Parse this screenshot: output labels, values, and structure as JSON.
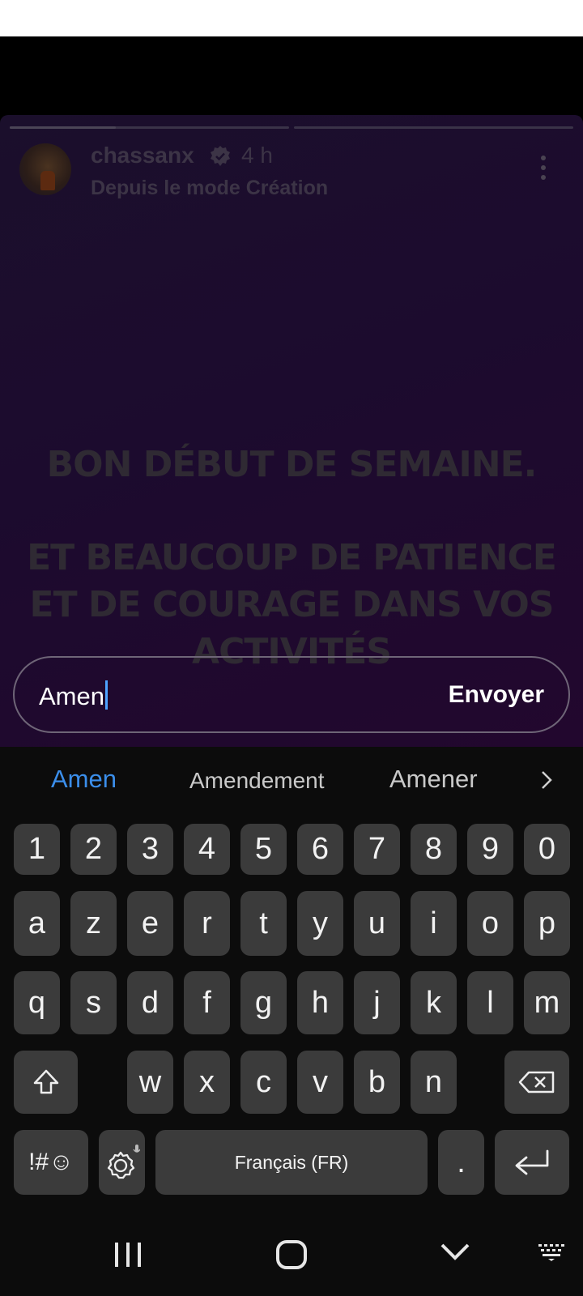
{
  "story": {
    "username": "chassanx",
    "time": "4 h",
    "subtitle": "Depuis le mode Création",
    "text_line1": "BON DÉBUT DE SEMAINE.",
    "text_line2": "ET BEAUCOUP DE PATIENCE",
    "text_line3": "ET DE COURAGE DANS VOS",
    "text_line4": "ACTIVITÉS",
    "progress": [
      0.38,
      0
    ]
  },
  "reply": {
    "value": "Amen",
    "send_label": "Envoyer"
  },
  "keyboard": {
    "suggestions": [
      "Amen",
      "Amendement",
      "Amener"
    ],
    "numbers": [
      "1",
      "2",
      "3",
      "4",
      "5",
      "6",
      "7",
      "8",
      "9",
      "0"
    ],
    "row1": [
      "a",
      "z",
      "e",
      "r",
      "t",
      "y",
      "u",
      "i",
      "o",
      "p"
    ],
    "row2": [
      "q",
      "s",
      "d",
      "f",
      "g",
      "h",
      "j",
      "k",
      "l",
      "m"
    ],
    "row3": [
      "w",
      "x",
      "c",
      "v",
      "b",
      "n"
    ],
    "symbols_label": "!#☺",
    "space_label": "Français (FR)",
    "period_label": "."
  },
  "icons": {
    "verified": "verified-badge-icon",
    "more": "more-vertical-icon",
    "shift": "shift-icon",
    "backspace": "backspace-icon",
    "settings": "settings-icon",
    "enter": "enter-icon",
    "recent_apps": "recent-apps-icon",
    "home": "home-icon",
    "hide_keyboard": "chevron-down-icon",
    "keyboard": "keyboard-icon"
  }
}
